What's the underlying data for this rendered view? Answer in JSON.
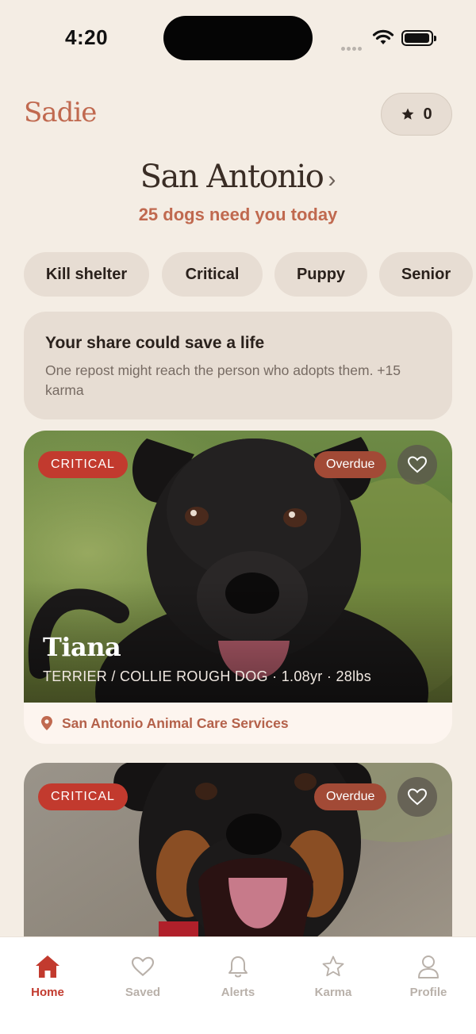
{
  "status": {
    "time": "4:20"
  },
  "header": {
    "logo": "Sadie",
    "karma_count": "0"
  },
  "location": {
    "city": "San Antonio",
    "chevron": "›",
    "subtitle": "25 dogs need you today"
  },
  "filters": [
    "Kill shelter",
    "Critical",
    "Puppy",
    "Senior"
  ],
  "banner": {
    "title": "Your share could save a life",
    "text": "One repost might reach the person who adopts them. +15 karma"
  },
  "dogs": [
    {
      "badge": "CRITICAL",
      "status": "Overdue",
      "name": "Tiana",
      "meta": "TERRIER / COLLIE ROUGH DOG · 1.08yr · 28lbs",
      "shelter": "San Antonio Animal Care Services"
    },
    {
      "badge": "CRITICAL",
      "status": "Overdue"
    }
  ],
  "tabs": [
    {
      "label": "Home",
      "icon": "home-icon",
      "active": true
    },
    {
      "label": "Saved",
      "icon": "heart-icon"
    },
    {
      "label": "Alerts",
      "icon": "bell-icon"
    },
    {
      "label": "Karma",
      "icon": "star-icon"
    },
    {
      "label": "Profile",
      "icon": "person-icon"
    }
  ],
  "colors": {
    "accent": "#c0694f",
    "critical": "#c23a2e",
    "overdue": "#a24a36",
    "background": "#f4ede4"
  }
}
